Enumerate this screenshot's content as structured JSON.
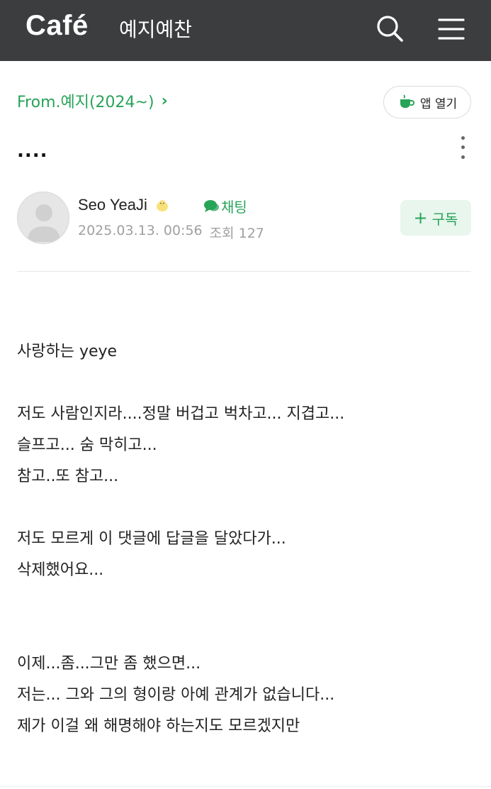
{
  "header": {
    "logo": "Café",
    "cafe_name": "예지예찬",
    "icons": [
      "search-icon",
      "menu-icon"
    ]
  },
  "board": {
    "link_label": "From.예지(2024~)",
    "chevron": "›"
  },
  "app_open": {
    "label": "앱 열기",
    "icon": "cup-icon"
  },
  "post": {
    "title": "....",
    "author": "Seo YeaJi",
    "chat_label": "채팅",
    "date": "2025.03.13. 00:56",
    "views_label": "조회 127",
    "subscribe_label": "구독"
  },
  "body_lines": [
    "사랑하는 yeye",
    "",
    "저도 사람인지라....정말 버겁고 벅차고... 지겹고...",
    "슬프고... 숨 막히고...",
    "참고..또 참고...",
    "",
    "저도 모르게 이 댓글에 답글을 달았다가...",
    "삭제했어요...",
    "",
    "",
    "이제...좀...그만 좀 했으면...",
    "저는... 그와 그의 형이랑 아예 관계가 없습니다...",
    "제가 이걸 왜 해명해야 하는지도 모르겠지만"
  ],
  "colors": {
    "topbar": "#3c3d3f",
    "accent_green": "#27a458",
    "subscribe_bg": "#e8f6ed",
    "meta_gray": "#a0a0a0"
  }
}
